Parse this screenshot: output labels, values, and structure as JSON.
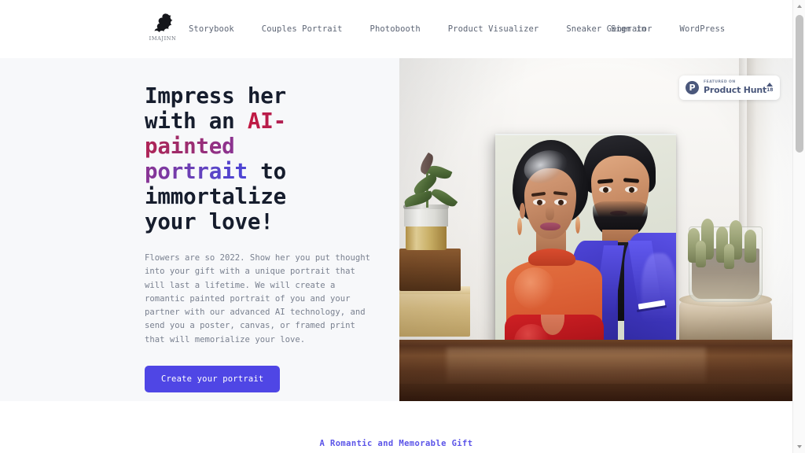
{
  "brand": {
    "logo_icon": "imajinn-genie-icon",
    "wordmark": "IMAJINN"
  },
  "nav": {
    "items": [
      {
        "label": "Storybook"
      },
      {
        "label": "Couples Portrait"
      },
      {
        "label": "Photobooth"
      },
      {
        "label": "Product Visualizer"
      },
      {
        "label": "Sneaker Generator"
      },
      {
        "label": "WordPress"
      }
    ],
    "signin_label": "Sign in"
  },
  "hero": {
    "headline": {
      "part1": "Impress her with an ",
      "gradient": "AI-painted portrait",
      "part2": " to immortalize your love!"
    },
    "body": "Flowers are so 2022. Show her you put thought into your gift with a unique portrait that will last a lifetime. We will create a romantic painted portrait of you and your partner with our advanced AI technology, and send you a poster, canvas, or framed print that will memorialize your love.",
    "cta_label": "Create your portrait",
    "image_alt": "AI painted canvas portrait of a couple displayed on a wooden shelf beside a potted plant and a cactus in a glass jar"
  },
  "product_hunt": {
    "kicker": "FEATURED ON",
    "name": "Product Hunt",
    "logo_letter": "P",
    "upvotes": "18"
  },
  "section": {
    "eyebrow": "A Romantic and Memorable Gift"
  },
  "scrollbar": {
    "up_icon": "chevron-up-icon",
    "down_icon": "chevron-down-icon"
  },
  "colors": {
    "accent": "#4f46e5",
    "eyebrow": "#5b54e8",
    "gradient_start": "#c3173f",
    "gradient_end": "#4a43d6",
    "headline": "#161d2d",
    "body_text": "#7a8190",
    "nav_text": "#5d6575",
    "hero_bg": "#f7f8fa",
    "product_hunt": "#4b587c"
  }
}
